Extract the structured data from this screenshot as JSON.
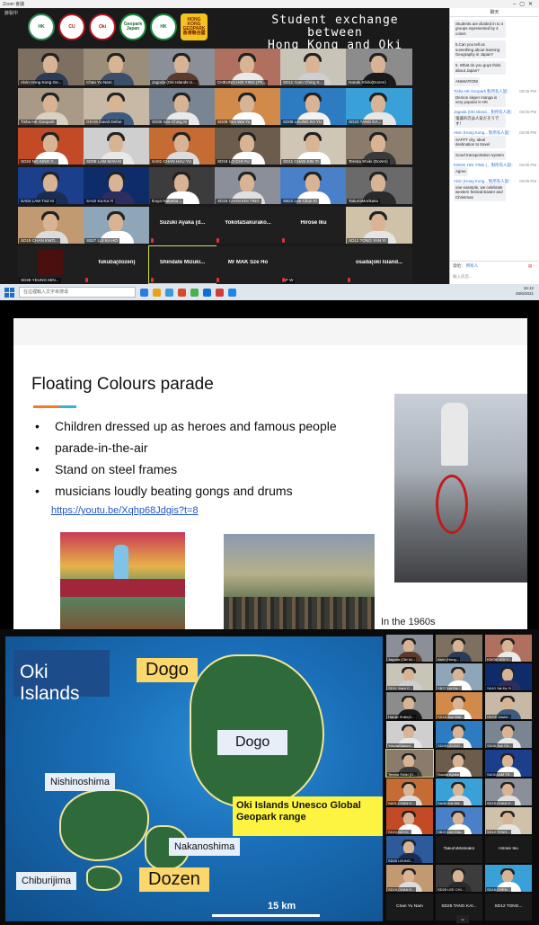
{
  "window": {
    "title": "Zoom 會議",
    "recording": "錄製中"
  },
  "header": {
    "title_line1": "Student exchange between",
    "title_line2": "Hong Kong and Oki Islands",
    "logos": [
      "HK",
      "CU",
      "Oki",
      "Geopark Japan",
      "HK",
      "HONG KONG GEOPARK 香港聯合國"
    ]
  },
  "gallery": {
    "tiles": [
      {
        "name": "Alvin Hong Kong Ge...",
        "type": "video",
        "col": 0,
        "row": 0,
        "shirt": "#2b3a55",
        "bg": "#7d7060"
      },
      {
        "name": "Chan Yu Nam",
        "type": "video",
        "col": 1,
        "row": 0,
        "shirt": "#3b4f6b",
        "bg": "#9a8e7a"
      },
      {
        "name": "Jagoda (Oki Islands U...",
        "type": "video",
        "col": 2,
        "row": 0,
        "shirt": "#5a3a2c",
        "bg": "#8b8f98"
      },
      {
        "name": "CHEUNG HOI YING (Ph...",
        "type": "video",
        "col": 3,
        "row": 0,
        "shirt": "#e9e9e9",
        "bg": "#b07060"
      },
      {
        "name": "SD11 Yuen Ching S...",
        "type": "video",
        "col": 4,
        "row": 0,
        "shirt": "#cfcfcf",
        "bg": "#c9c4b8"
      },
      {
        "name": "Haruki Shiiki(Dozen)",
        "type": "video",
        "col": 5,
        "row": 0,
        "shirt": "#1a1a1a",
        "bg": "#8c8c8c"
      },
      {
        "name": "Tisha HK Geopark",
        "type": "video",
        "col": 0,
        "row": 1,
        "shirt": "#d8d0c0",
        "bg": "#a99a88"
      },
      {
        "name": "OKHS David Defoe",
        "type": "video",
        "col": 1,
        "row": 1,
        "shirt": "#3d5a80",
        "bg": "#c7b9a5"
      },
      {
        "name": "SD06 Sze Ching Ki",
        "type": "video",
        "col": 2,
        "row": 1,
        "shirt": "#e9e9e9",
        "bg": "#7a8594"
      },
      {
        "name": "SD09 Tsoi Wai Yu",
        "type": "video",
        "col": 3,
        "row": 1,
        "shirt": "#ffffff",
        "bg": "#d18a4a"
      },
      {
        "name": "SD09 LEUNG KA YU",
        "type": "video",
        "col": 4,
        "row": 1,
        "shirt": "#f2f2f2",
        "bg": "#2d7bc0"
      },
      {
        "name": "SD23 TANG KA...",
        "type": "video",
        "col": 5,
        "row": 1,
        "shirt": "#e7e7e7",
        "bg": "#3aa0d8"
      },
      {
        "name": "SD24 NG KING Y...",
        "type": "video",
        "col": 0,
        "row": 2,
        "shirt": "#ffffff",
        "bg": "#c24a26"
      },
      {
        "name": "SD08 LAM MAN KI",
        "type": "video",
        "col": 1,
        "row": 2,
        "shirt": "#e8e8e8",
        "bg": "#cfcfcf"
      },
      {
        "name": "SA01 CHAN HAU YU",
        "type": "video",
        "col": 2,
        "row": 2,
        "shirt": "#dcdcdc",
        "bg": "#c56b34"
      },
      {
        "name": "SD18 LO CHI YU",
        "type": "video",
        "col": 3,
        "row": 2,
        "shirt": "#ffffff",
        "bg": "#6c5c4c"
      },
      {
        "name": "SD11 CHAN KIN TI",
        "type": "video",
        "col": 4,
        "row": 2,
        "shirt": "#ffffff",
        "bg": "#cfc6b6"
      },
      {
        "name": "Teresa Shiiki (Dozen)",
        "type": "video",
        "col": 5,
        "row": 2,
        "shirt": "#3a3a3a",
        "bg": "#8a7b6a"
      },
      {
        "name": "SA04 LAM TSZ KI",
        "type": "video",
        "col": 0,
        "row": 3,
        "shirt": "#1a2e55",
        "bg": "#1b3f8a"
      },
      {
        "name": "SA10 Ka Ka Yi",
        "type": "video",
        "col": 1,
        "row": 3,
        "shirt": "#2e2e5e",
        "bg": "#0f2c6a"
      },
      {
        "name": "Ikuya Nakamu...",
        "type": "video",
        "col": 2,
        "row": 3,
        "shirt": "#ffffff",
        "bg": "#3c3c3c"
      },
      {
        "name": "SD15 CHAN KIN TING",
        "type": "video",
        "col": 3,
        "row": 3,
        "shirt": "#e0e0e0",
        "bg": "#8a8f99"
      },
      {
        "name": "SB22 Lee Chun Ki",
        "type": "video",
        "col": 4,
        "row": 3,
        "shirt": "#ffffff",
        "bg": "#4a80c8"
      },
      {
        "name": "TakumiMorikako",
        "type": "video",
        "col": 5,
        "row": 3,
        "shirt": "#2a2a2a",
        "bg": "#6a6a6a"
      },
      {
        "name": "SD19 CHAN KWO...",
        "type": "video",
        "col": 0,
        "row": 4,
        "shirt": "#dcdcdc",
        "bg": "#c29a72"
      },
      {
        "name": "SB27 LUI KA HO",
        "type": "video",
        "col": 1,
        "row": 4,
        "shirt": "#ffffff",
        "bg": "#8fa5b8"
      },
      {
        "name": "Suzuki Ayaka (d...",
        "type": "blank",
        "col": 2,
        "row": 4
      },
      {
        "name": "YokotaSakurako...",
        "type": "blank",
        "col": 3,
        "row": 4
      },
      {
        "name": "Hirose Iku",
        "type": "blank",
        "col": 4,
        "row": 4
      },
      {
        "name": "SD12 TONG YAN YI",
        "type": "video",
        "col": 5,
        "row": 4,
        "shirt": "#e5e5e5",
        "bg": "#d0c2a8"
      },
      {
        "name": "SD28 YEUNG MIN...",
        "type": "dark",
        "col": 0,
        "row": 5
      },
      {
        "name": "fukuba(dozen)",
        "type": "blank",
        "col": 1,
        "row": 5
      },
      {
        "name": "Shindate Mizuki...",
        "type": "blank",
        "col": 2,
        "row": 5,
        "highlight": true
      },
      {
        "name": "Mr MAK Sze Ho",
        "type": "blank",
        "col": 3,
        "row": 5
      },
      {
        "name": "SF W",
        "type": "blank",
        "col": 4,
        "row": 5,
        "showlabel": true
      },
      {
        "name": "osada(oki Island...",
        "type": "blank",
        "col": 5,
        "row": 5
      }
    ]
  },
  "chat": {
    "header": "聊天",
    "messages": [
      {
        "text": "Students are divided in to 4 groups represented by 4 colors"
      },
      {
        "text": "5.Can you tell us something about learning Geography in Japan?"
      },
      {
        "text": "5. What do you guys think about Japan?"
      },
      {
        "text": "ANIMATION!"
      },
      {
        "who": "Tisha HK Geopark 對所有人說：",
        "time": "03:06 PM",
        "text": "Demon slayer manga is very popular in HK"
      },
      {
        "who": "Jagoda (Oki Island... 對所有人說：",
        "time": "03:06 PM",
        "text": "鬼滅の刃は人気だそうです！"
      },
      {
        "who": "Alvin (Hong Kong... 對所有人說：",
        "time": "03:06 PM",
        "text": "SAFFT city, ideal destination to travel"
      },
      {
        "text": "Good transportation system"
      },
      {
        "who": "KWOK HOI YING (... 對所有人說：",
        "time": "04:05 PM",
        "text": "Agree"
      },
      {
        "who": "Alvin (Hong Kong... 對所有人說：",
        "time": "04:05 PM",
        "text": "one example, we celebrate western festival:Easter and Christmas"
      }
    ],
    "footer_to": "發給：",
    "footer_to_value": "所有人",
    "input_placeholder": "輸入訊息..."
  },
  "taskbar": {
    "search_placeholder": "在這裡輸入文字來搜尋",
    "time": "16:12",
    "date": "25/6/2021",
    "app_colors": [
      "#2a7de1",
      "#e8a317",
      "#3c9bd6",
      "#d94a2a",
      "#4caf50",
      "#0f6fd6",
      "#d03c3c",
      "#1e88e5"
    ]
  },
  "slide": {
    "title": "Floating Colours parade",
    "bullets": [
      "Children dressed up as heroes and famous people",
      "parade-in-the-air",
      "Stand on steel frames",
      "musicians loudly beating gongs and drums"
    ],
    "link": "https://youtu.be/Xqhp68Jdgis?t=8",
    "caption": "In the 1960s"
  },
  "map": {
    "title": "Oki Islands",
    "labels": {
      "dogo_top": "Dogo",
      "dogo_main": "Dogo",
      "nishinoshima": "Nishinoshima",
      "nakanoshima": "Nakanoshima",
      "chiburijima": "Chiburijima",
      "dozen": "Dozen"
    },
    "geopark_label": "Oki Islands Unesco Global Geopark range",
    "scale": "15 km"
  },
  "gallery2": {
    "tiles": [
      {
        "name": "Jagoda (Oki Isl...",
        "type": "video",
        "col": 0,
        "row": 0,
        "shirt": "#5a3a2c",
        "bg": "#8b8f98"
      },
      {
        "name": "Alvin (Hong...",
        "type": "video",
        "col": 1,
        "row": 0,
        "shirt": "#2b3a55",
        "bg": "#7d7060"
      },
      {
        "name": "KWOK HOI Y...",
        "type": "video",
        "col": 2,
        "row": 0,
        "shirt": "#e9e9e9",
        "bg": "#b07060"
      },
      {
        "name": "SD11 Yuen C...",
        "type": "video",
        "col": 0,
        "row": 1,
        "shirt": "#cfcfcf",
        "bg": "#c9c4b8"
      },
      {
        "name": "SB27 Lui Ka...",
        "type": "video",
        "col": 1,
        "row": 1,
        "shirt": "#ffffff",
        "bg": "#8fa5b8"
      },
      {
        "name": "SA10 Yat Ka Yi",
        "type": "video",
        "col": 2,
        "row": 1,
        "shirt": "#2e2e5e",
        "bg": "#0f2c6a"
      },
      {
        "name": "Haruki Shiiki(D...",
        "type": "video",
        "col": 0,
        "row": 2,
        "shirt": "#1a1a1a",
        "bg": "#8c8c8c"
      },
      {
        "name": "SD18 Tsoi Wai...",
        "type": "video",
        "col": 1,
        "row": 2,
        "shirt": "#ffffff",
        "bg": "#d18a4a"
      },
      {
        "name": "OKHS David...",
        "type": "video",
        "col": 2,
        "row": 2,
        "shirt": "#3d5a80",
        "bg": "#c7b9a5"
      },
      {
        "name": "YokotaSakura...",
        "type": "video",
        "col": 0,
        "row": 3,
        "shirt": "#e8e8e8",
        "bg": "#cfcfcf"
      },
      {
        "name": "SD09 LEUNG...",
        "type": "video",
        "col": 1,
        "row": 3,
        "shirt": "#f2f2f2",
        "bg": "#2d7bc0"
      },
      {
        "name": "SD06 Sze Ch...",
        "type": "video",
        "col": 2,
        "row": 3,
        "shirt": "#e9e9e9",
        "bg": "#7a8594"
      },
      {
        "name": "Teresa Shiiki (D...",
        "type": "video",
        "col": 0,
        "row": 4,
        "shirt": "#3a3a3a",
        "bg": "#8a7b6a",
        "highlight": true
      },
      {
        "name": "Suzuki Ayaka",
        "type": "video",
        "col": 1,
        "row": 4,
        "shirt": "#ffffff",
        "bg": "#6c5c4c"
      },
      {
        "name": "SA04 LAM TS...",
        "type": "video",
        "col": 2,
        "row": 4,
        "shirt": "#ffffff",
        "bg": "#1b3f8a"
      },
      {
        "name": "SA01 CHAN H...",
        "type": "video",
        "col": 0,
        "row": 5,
        "shirt": "#dcdcdc",
        "bg": "#c56b34"
      },
      {
        "name": "SA08 Yuk Wa...",
        "type": "video",
        "col": 1,
        "row": 5,
        "shirt": "#e0e0e0",
        "bg": "#3aa0d8"
      },
      {
        "name": "SD15 CHAN K...",
        "type": "video",
        "col": 2,
        "row": 5,
        "shirt": "#e0e0e0",
        "bg": "#8a8f99"
      },
      {
        "name": "SD24 NG Ki...",
        "type": "video",
        "col": 0,
        "row": 6,
        "shirt": "#ffffff",
        "bg": "#c24a26"
      },
      {
        "name": "SB22 Lee Chu...",
        "type": "video",
        "col": 1,
        "row": 6,
        "shirt": "#ffffff",
        "bg": "#4a80c8"
      },
      {
        "name": "SD12 TONG...",
        "type": "video",
        "col": 2,
        "row": 6,
        "shirt": "#e5e5e5",
        "bg": "#d0c2a8"
      },
      {
        "name": "SD09 LEUNG...",
        "type": "video",
        "col": 0,
        "row": 7,
        "shirt": "#1a2e55",
        "bg": "#2c5a9a"
      },
      {
        "name": "TakumiMorikako",
        "type": "blank",
        "col": 1,
        "row": 7
      },
      {
        "name": "Hirose Iku",
        "type": "blank",
        "col": 2,
        "row": 7
      },
      {
        "name": "SD19 CHAN K...",
        "type": "video",
        "col": 0,
        "row": 8,
        "shirt": "#dcdcdc",
        "bg": "#c29a72"
      },
      {
        "name": "SD28 LEE CHI...",
        "type": "video",
        "col": 1,
        "row": 8,
        "shirt": "#2a2a2a",
        "bg": "#3c3c3c"
      },
      {
        "name": "SD16 CHEN...",
        "type": "video",
        "col": 2,
        "row": 8,
        "shirt": "#ffffff",
        "bg": "#3aa0d8"
      },
      {
        "name": "Chan Yu Nam",
        "type": "blank",
        "col": 0,
        "row": 9
      },
      {
        "name": "SD25 TANG KAI...",
        "type": "blank",
        "col": 1,
        "row": 9
      },
      {
        "name": "SD12 TONG...",
        "type": "blank",
        "col": 2,
        "row": 9
      }
    ]
  }
}
